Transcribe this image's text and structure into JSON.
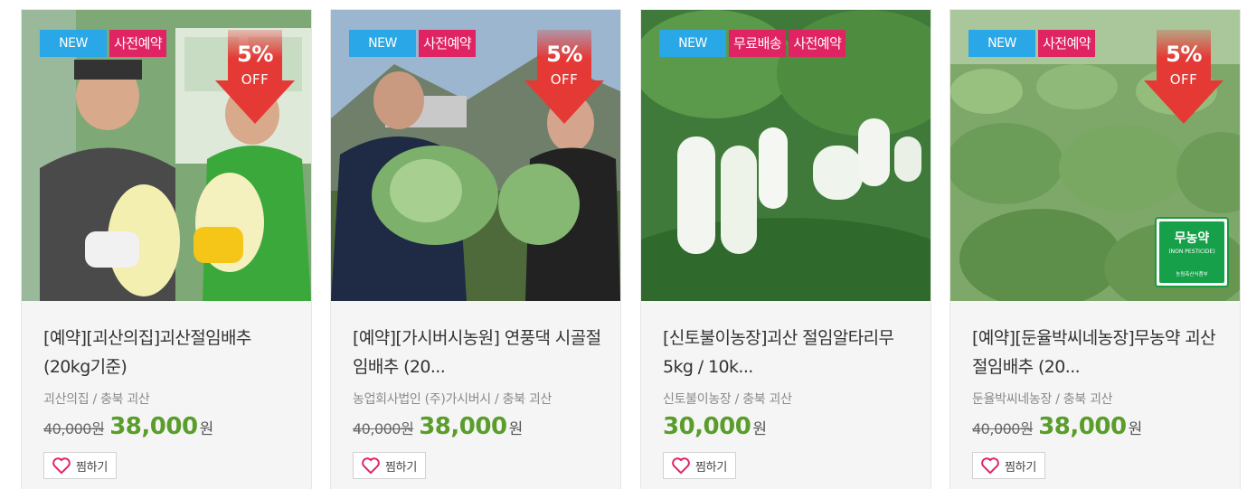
{
  "colors": {
    "new_badge": "#2aa7e6",
    "tag_badge": "#e02463",
    "discount_arrow": "#e53935",
    "price": "#5a9d2b"
  },
  "products": [
    {
      "badges": [
        "NEW",
        "사전예약"
      ],
      "discount_pct": "5%",
      "discount_off": "OFF",
      "title": "[예약][괴산의집]괴산절임배추 (20kg기준)",
      "seller": "괴산의집 / 충북 괴산",
      "original_price": "40,000원",
      "price": "38,000",
      "won": "원",
      "wish_label": "찜하기"
    },
    {
      "badges": [
        "NEW",
        "사전예약"
      ],
      "discount_pct": "5%",
      "discount_off": "OFF",
      "title": "[예약][가시버시농원] 연풍댁 시골절임배추 (20...",
      "seller": "농업회사법인 (주)가시버시 / 충북 괴산",
      "original_price": "40,000원",
      "price": "38,000",
      "won": "원",
      "wish_label": "찜하기"
    },
    {
      "badges": [
        "NEW",
        "무료배송",
        "사전예약"
      ],
      "title": "[신토불이농장]괴산 절임알타리무 5kg / 10k...",
      "seller": "신토불이농장 / 충북 괴산",
      "price": "30,000",
      "won": "원",
      "wish_label": "찜하기"
    },
    {
      "badges": [
        "NEW",
        "사전예약"
      ],
      "discount_pct": "5%",
      "discount_off": "OFF",
      "title": "[예약][둔율박씨네농장]무농약 괴산절임배추 (20...",
      "seller": "둔율박씨네농장 / 충북 괴산",
      "original_price": "40,000원",
      "price": "38,000",
      "won": "원",
      "wish_label": "찜하기",
      "cert_mark": {
        "label": "무농약",
        "sub": "(NON PESTICIDE)",
        "agency": "농림축산식품부"
      }
    }
  ]
}
